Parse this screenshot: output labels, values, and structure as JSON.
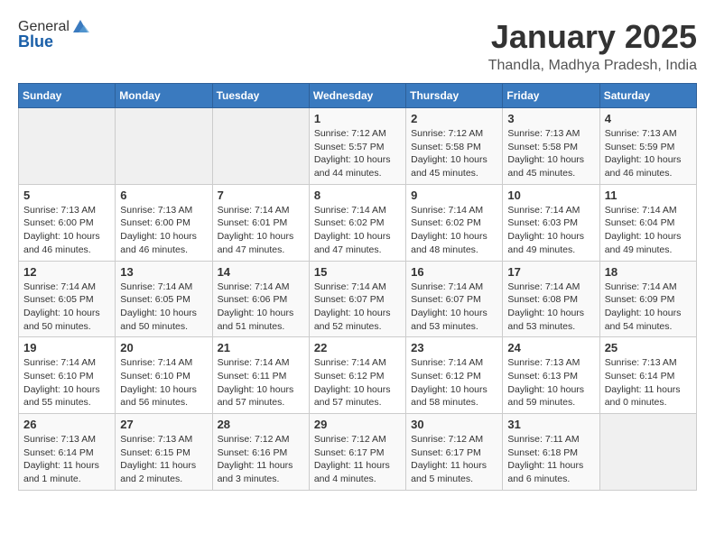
{
  "header": {
    "logo_line1": "General",
    "logo_line2": "Blue",
    "month_title": "January 2025",
    "subtitle": "Thandla, Madhya Pradesh, India"
  },
  "weekdays": [
    "Sunday",
    "Monday",
    "Tuesday",
    "Wednesday",
    "Thursday",
    "Friday",
    "Saturday"
  ],
  "weeks": [
    [
      {
        "day": "",
        "info": ""
      },
      {
        "day": "",
        "info": ""
      },
      {
        "day": "",
        "info": ""
      },
      {
        "day": "1",
        "info": "Sunrise: 7:12 AM\nSunset: 5:57 PM\nDaylight: 10 hours\nand 44 minutes."
      },
      {
        "day": "2",
        "info": "Sunrise: 7:12 AM\nSunset: 5:58 PM\nDaylight: 10 hours\nand 45 minutes."
      },
      {
        "day": "3",
        "info": "Sunrise: 7:13 AM\nSunset: 5:58 PM\nDaylight: 10 hours\nand 45 minutes."
      },
      {
        "day": "4",
        "info": "Sunrise: 7:13 AM\nSunset: 5:59 PM\nDaylight: 10 hours\nand 46 minutes."
      }
    ],
    [
      {
        "day": "5",
        "info": "Sunrise: 7:13 AM\nSunset: 6:00 PM\nDaylight: 10 hours\nand 46 minutes."
      },
      {
        "day": "6",
        "info": "Sunrise: 7:13 AM\nSunset: 6:00 PM\nDaylight: 10 hours\nand 46 minutes."
      },
      {
        "day": "7",
        "info": "Sunrise: 7:14 AM\nSunset: 6:01 PM\nDaylight: 10 hours\nand 47 minutes."
      },
      {
        "day": "8",
        "info": "Sunrise: 7:14 AM\nSunset: 6:02 PM\nDaylight: 10 hours\nand 47 minutes."
      },
      {
        "day": "9",
        "info": "Sunrise: 7:14 AM\nSunset: 6:02 PM\nDaylight: 10 hours\nand 48 minutes."
      },
      {
        "day": "10",
        "info": "Sunrise: 7:14 AM\nSunset: 6:03 PM\nDaylight: 10 hours\nand 49 minutes."
      },
      {
        "day": "11",
        "info": "Sunrise: 7:14 AM\nSunset: 6:04 PM\nDaylight: 10 hours\nand 49 minutes."
      }
    ],
    [
      {
        "day": "12",
        "info": "Sunrise: 7:14 AM\nSunset: 6:05 PM\nDaylight: 10 hours\nand 50 minutes."
      },
      {
        "day": "13",
        "info": "Sunrise: 7:14 AM\nSunset: 6:05 PM\nDaylight: 10 hours\nand 50 minutes."
      },
      {
        "day": "14",
        "info": "Sunrise: 7:14 AM\nSunset: 6:06 PM\nDaylight: 10 hours\nand 51 minutes."
      },
      {
        "day": "15",
        "info": "Sunrise: 7:14 AM\nSunset: 6:07 PM\nDaylight: 10 hours\nand 52 minutes."
      },
      {
        "day": "16",
        "info": "Sunrise: 7:14 AM\nSunset: 6:07 PM\nDaylight: 10 hours\nand 53 minutes."
      },
      {
        "day": "17",
        "info": "Sunrise: 7:14 AM\nSunset: 6:08 PM\nDaylight: 10 hours\nand 53 minutes."
      },
      {
        "day": "18",
        "info": "Sunrise: 7:14 AM\nSunset: 6:09 PM\nDaylight: 10 hours\nand 54 minutes."
      }
    ],
    [
      {
        "day": "19",
        "info": "Sunrise: 7:14 AM\nSunset: 6:10 PM\nDaylight: 10 hours\nand 55 minutes."
      },
      {
        "day": "20",
        "info": "Sunrise: 7:14 AM\nSunset: 6:10 PM\nDaylight: 10 hours\nand 56 minutes."
      },
      {
        "day": "21",
        "info": "Sunrise: 7:14 AM\nSunset: 6:11 PM\nDaylight: 10 hours\nand 57 minutes."
      },
      {
        "day": "22",
        "info": "Sunrise: 7:14 AM\nSunset: 6:12 PM\nDaylight: 10 hours\nand 57 minutes."
      },
      {
        "day": "23",
        "info": "Sunrise: 7:14 AM\nSunset: 6:12 PM\nDaylight: 10 hours\nand 58 minutes."
      },
      {
        "day": "24",
        "info": "Sunrise: 7:13 AM\nSunset: 6:13 PM\nDaylight: 10 hours\nand 59 minutes."
      },
      {
        "day": "25",
        "info": "Sunrise: 7:13 AM\nSunset: 6:14 PM\nDaylight: 11 hours\nand 0 minutes."
      }
    ],
    [
      {
        "day": "26",
        "info": "Sunrise: 7:13 AM\nSunset: 6:14 PM\nDaylight: 11 hours\nand 1 minute."
      },
      {
        "day": "27",
        "info": "Sunrise: 7:13 AM\nSunset: 6:15 PM\nDaylight: 11 hours\nand 2 minutes."
      },
      {
        "day": "28",
        "info": "Sunrise: 7:12 AM\nSunset: 6:16 PM\nDaylight: 11 hours\nand 3 minutes."
      },
      {
        "day": "29",
        "info": "Sunrise: 7:12 AM\nSunset: 6:17 PM\nDaylight: 11 hours\nand 4 minutes."
      },
      {
        "day": "30",
        "info": "Sunrise: 7:12 AM\nSunset: 6:17 PM\nDaylight: 11 hours\nand 5 minutes."
      },
      {
        "day": "31",
        "info": "Sunrise: 7:11 AM\nSunset: 6:18 PM\nDaylight: 11 hours\nand 6 minutes."
      },
      {
        "day": "",
        "info": ""
      }
    ]
  ]
}
